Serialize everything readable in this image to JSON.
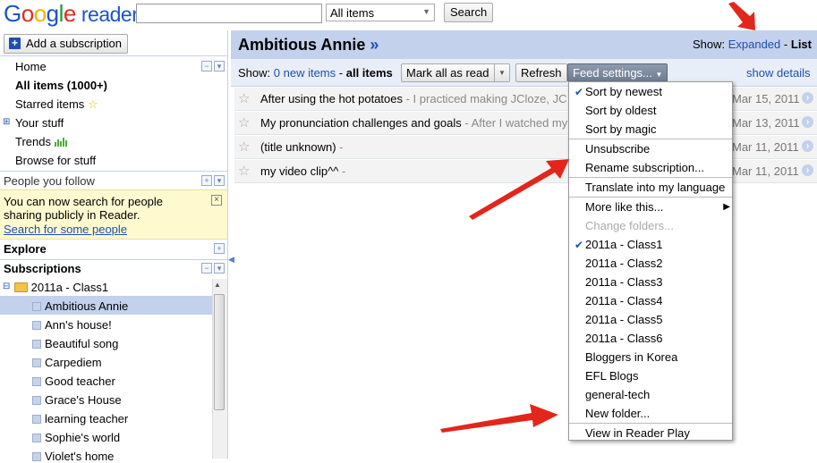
{
  "app": {
    "logo_google": "Google",
    "logo_product": "reader"
  },
  "search": {
    "value": "",
    "scope": "All items",
    "button": "Search"
  },
  "sidebar": {
    "add_subscription": "Add a subscription",
    "nav": {
      "home": "Home",
      "all_items": "All items (1000+)",
      "starred": "Starred items",
      "your_stuff": "Your stuff",
      "trends": "Trends",
      "browse": "Browse for stuff"
    },
    "people_you_follow": "People you follow",
    "notice": {
      "text": "You can now search for people sharing publicly in Reader.",
      "link": "Search for some people"
    },
    "explore": "Explore",
    "subscriptions": "Subscriptions",
    "folder": "2011a - Class1",
    "feeds": [
      "Ambitious Annie",
      "Ann's house!",
      "Beautiful song",
      "Carpediem",
      "Good teacher",
      "Grace's House",
      "learning teacher",
      "Sophie's world",
      "Violet's home"
    ]
  },
  "main": {
    "feed_title": "Ambitious Annie",
    "feed_title_suffix": "»",
    "view": {
      "label": "Show:",
      "expanded": "Expanded",
      "sep": "-",
      "list": "List"
    },
    "toolbar": {
      "show_label": "Show:",
      "new_items": "0 new items",
      "sep": "-",
      "all_items": "all items",
      "mark_all_read": "Mark all as read",
      "refresh": "Refresh",
      "feed_settings": "Feed settings...",
      "show_details": "show details"
    },
    "entries": [
      {
        "title": "After using the hot potatoes",
        "snippet": " - I practiced making JCloze, JC",
        "date": "Mar 15, 2011"
      },
      {
        "title": "My pronunciation challenges and goals",
        "snippet": " - After I watched my",
        "date": "Mar 13, 2011"
      },
      {
        "title": "(title unknown)",
        "snippet": " -",
        "date": "Mar 11, 2011"
      },
      {
        "title": "my video clip^^",
        "snippet": " -",
        "date": "Mar 11, 2011"
      }
    ]
  },
  "menu": {
    "sort_newest": "Sort by newest",
    "sort_oldest": "Sort by oldest",
    "sort_magic": "Sort by magic",
    "unsubscribe": "Unsubscribe",
    "rename": "Rename subscription...",
    "translate": "Translate into my language",
    "more_like": "More like this...",
    "change_folders": "Change folders...",
    "folders": [
      "2011a - Class1",
      "2011a - Class2",
      "2011a - Class3",
      "2011a - Class4",
      "2011a - Class5",
      "2011a - Class6",
      "Bloggers in Korea",
      "EFL Blogs",
      "general-tech"
    ],
    "new_folder": "New folder...",
    "view_in_play": "View in Reader Play"
  },
  "colors": {
    "accent": "#1f4fb4",
    "header_bg": "#c3d1ec",
    "notice_bg": "#fff9cf",
    "arrow": "#e3261c"
  }
}
